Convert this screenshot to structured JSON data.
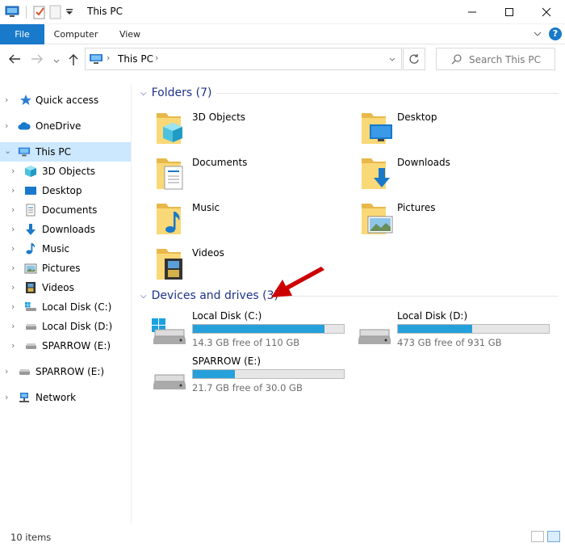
{
  "window": {
    "title": "This PC"
  },
  "ribbon": {
    "tabs": [
      "File",
      "Computer",
      "View"
    ]
  },
  "address": {
    "crumb": "This PC",
    "search_placeholder": "Search This PC"
  },
  "nav": {
    "items": [
      {
        "label": "Quick access"
      },
      {
        "label": "OneDrive"
      },
      {
        "label": "This PC"
      },
      {
        "label": "3D Objects"
      },
      {
        "label": "Desktop"
      },
      {
        "label": "Documents"
      },
      {
        "label": "Downloads"
      },
      {
        "label": "Music"
      },
      {
        "label": "Pictures"
      },
      {
        "label": "Videos"
      },
      {
        "label": "Local Disk (C:)"
      },
      {
        "label": "Local Disk (D:)"
      },
      {
        "label": "SPARROW (E:)"
      },
      {
        "label": "SPARROW (E:)"
      },
      {
        "label": "Network"
      }
    ]
  },
  "folders": {
    "header": "Folders (7)",
    "items": [
      {
        "label": "3D Objects",
        "icon": "3d-objects-folder-icon"
      },
      {
        "label": "Desktop",
        "icon": "desktop-folder-icon"
      },
      {
        "label": "Documents",
        "icon": "documents-folder-icon"
      },
      {
        "label": "Downloads",
        "icon": "downloads-folder-icon"
      },
      {
        "label": "Music",
        "icon": "music-folder-icon"
      },
      {
        "label": "Pictures",
        "icon": "pictures-folder-icon"
      },
      {
        "label": "Videos",
        "icon": "videos-folder-icon"
      }
    ]
  },
  "drives": {
    "header": "Devices and drives (3)",
    "items": [
      {
        "label": "Local Disk (C:)",
        "free": "14.3 GB free of 110 GB",
        "used_fraction": 0.87
      },
      {
        "label": "Local Disk (D:)",
        "free": "473 GB free of 931 GB",
        "used_fraction": 0.49
      },
      {
        "label": "SPARROW (E:)",
        "free": "21.7 GB free of 30.0 GB",
        "used_fraction": 0.28
      }
    ]
  },
  "status": {
    "count": "10 items"
  },
  "colors": {
    "accent": "#1979ca",
    "selection": "#cce8ff",
    "bar_fill": "#26a0da",
    "group_header": "#1e3287",
    "annotation_arrow": "#cc0000"
  }
}
